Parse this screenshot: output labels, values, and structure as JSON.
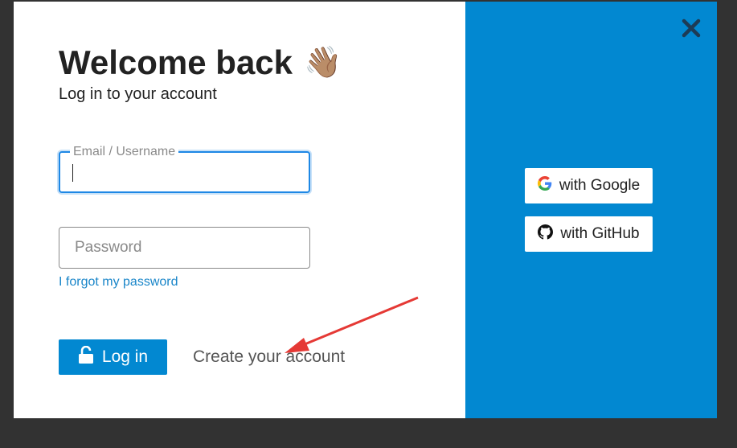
{
  "background": {
    "colors": {
      "overlay": "#323232"
    }
  },
  "modal": {
    "title": "Welcome back",
    "title_emoji": "👋🏽",
    "subtitle": "Log in to your account",
    "email_field": {
      "label": "Email / Username",
      "value": ""
    },
    "password_field": {
      "placeholder": "Password",
      "value": ""
    },
    "forgot_link": "I forgot my password",
    "login_button": {
      "label": "Log in",
      "icon": "unlock-icon"
    },
    "create_account_link": "Create your account",
    "close_icon": "close-icon",
    "social": {
      "google": {
        "label": "with Google",
        "icon": "google-icon"
      },
      "github": {
        "label": "with GitHub",
        "icon": "github-icon"
      }
    },
    "colors": {
      "accent": "#0288d1",
      "focus": "#1e88e5",
      "link": "#1a86c9",
      "annotation_arrow": "#e53935"
    }
  }
}
